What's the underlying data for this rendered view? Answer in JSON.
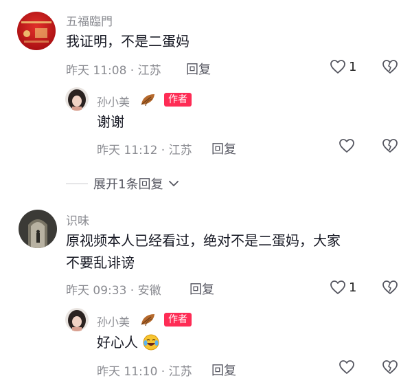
{
  "comments": [
    {
      "author": "五福臨門",
      "text": "我证明，不是二蛋妈",
      "meta": "昨天 11:08 · 江苏",
      "reply_label": "回复",
      "likes": "1",
      "replies": [
        {
          "author": "孙小美",
          "badge": "作者",
          "text": "谢谢",
          "meta": "昨天 11:12 · 江苏",
          "reply_label": "回复"
        }
      ],
      "expand_label": "展开1条回复"
    },
    {
      "author": "识味",
      "text_line1": "原视频本人已经看过，绝对不是二蛋妈，大家",
      "text_line2": "不要乱诽谤",
      "meta": "昨天 09:33 · 安徽",
      "reply_label": "回复",
      "likes": "1",
      "replies": [
        {
          "author": "孙小美",
          "badge": "作者",
          "text": "好心人",
          "meta": "昨天 11:10 · 江苏",
          "reply_label": "回复"
        }
      ]
    }
  ],
  "colors": {
    "badge": "#fe2c55",
    "muted_text": "#8a8b91",
    "primary_text": "#161823"
  },
  "icons": [
    "heart-outline-icon",
    "broken-heart-icon",
    "chevron-down-icon",
    "leaf-icon",
    "laughing-emoji-icon"
  ]
}
